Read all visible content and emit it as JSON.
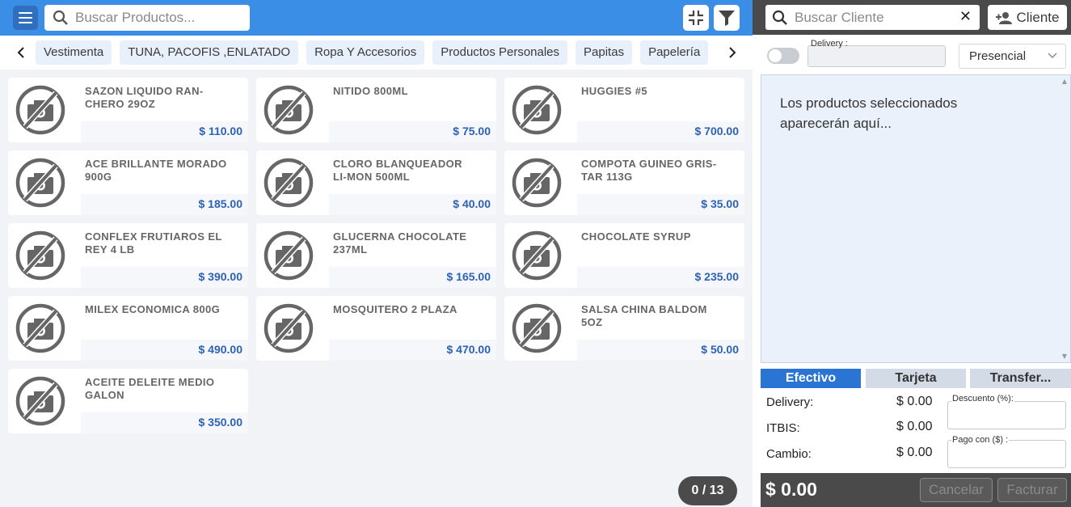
{
  "header": {
    "search_placeholder": "Buscar Productos...",
    "icons": [
      "menu-icon",
      "search-icon",
      "collapse-icon",
      "filter-icon"
    ]
  },
  "categories": [
    "Vestimenta",
    "TUNA, PACOFIS ,ENLATADO",
    "Ropa Y Accesorios",
    "Productos Personales",
    "Papitas",
    "Papelería"
  ],
  "products": [
    {
      "name": "SAZON LIQUIDO RAN-CHERO 29OZ",
      "price": "$ 110.00"
    },
    {
      "name": "NITIDO 800ML",
      "price": "$ 75.00"
    },
    {
      "name": "HUGGIES #5",
      "price": "$ 700.00"
    },
    {
      "name": "ACE BRILLANTE MORADO 900G",
      "price": "$ 185.00"
    },
    {
      "name": "CLORO BLANQUEADOR LI-MON 500ML",
      "price": "$ 40.00"
    },
    {
      "name": "COMPOTA GUINEO GRIS-TAR 113G",
      "price": "$ 35.00"
    },
    {
      "name": "CONFLEX FRUTIAROS EL REY 4 LB",
      "price": "$ 390.00"
    },
    {
      "name": "GLUCERNA CHOCOLATE 237ML",
      "price": "$ 165.00"
    },
    {
      "name": "CHOCOLATE SYRUP",
      "price": "$ 235.00"
    },
    {
      "name": "MILEX ECONOMICA 800G",
      "price": "$ 490.00"
    },
    {
      "name": "MOSQUITERO 2 PLAZA",
      "price": "$ 470.00"
    },
    {
      "name": "SALSA CHINA BALDOM 5OZ",
      "price": "$ 50.00"
    },
    {
      "name": "ACEITE DELEITE MEDIO GALON",
      "price": "$ 350.00"
    }
  ],
  "pager": "0 / 13",
  "client": {
    "search_placeholder": "Buscar Cliente",
    "clear": "✕",
    "client_button": "Cliente"
  },
  "order": {
    "delivery_label": "Delivery :",
    "mode": "Presencial",
    "empty_message": "Los productos seleccionados aparecerán aquí..."
  },
  "payment_tabs": [
    "Efectivo",
    "Tarjeta",
    "Transfer..."
  ],
  "active_payment_tab": "Efectivo",
  "summary": {
    "delivery_label": "Delivery:",
    "delivery_value": "$ 0.00",
    "itbis_label": "ITBIS:",
    "itbis_value": "$ 0.00",
    "cambio_label": "Cambio:",
    "cambio_value": "$ 0.00",
    "descuento_label": "Descuento (%):",
    "pago_label": "Pago con ($) :"
  },
  "footer": {
    "total": "$ 0.00",
    "cancel": "Cancelar",
    "invoice": "Facturar"
  },
  "colors": {
    "topbar": "#3a8ee6",
    "accent": "#2a74d4",
    "price": "#2e62b5",
    "dark": "#4a4a4a"
  }
}
